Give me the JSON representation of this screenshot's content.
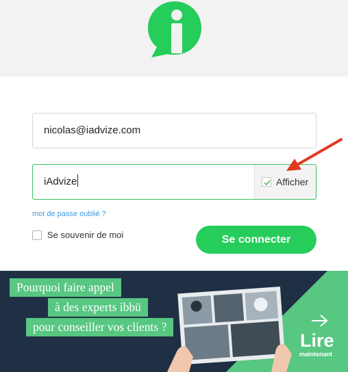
{
  "brand": {
    "accent": "#26cd5b",
    "link_color": "#3a9ad9",
    "banner_bg": "#1f3044",
    "banner_green": "#57c781"
  },
  "header": {
    "logo_icon": "iadvize-logo-icon"
  },
  "form": {
    "email_value": "nicolas@iadvize.com",
    "password_value": "iAdvize",
    "show_password_label": "Afficher",
    "show_password_checked": true,
    "forgot_password_label": "mot de passe oublié ?",
    "remember_me_label": "Se souvenir de moi",
    "remember_me_checked": false,
    "submit_label": "Se connecter"
  },
  "annotation": {
    "arrow_icon": "red-arrow-icon",
    "color": "#e0391c"
  },
  "banner": {
    "headline_lines": [
      "Pourquoi faire appel",
      "à des experts ibbü",
      "pour conseiller vos clients ?"
    ],
    "cta_main": "Lire",
    "cta_sub": "maintenant"
  }
}
